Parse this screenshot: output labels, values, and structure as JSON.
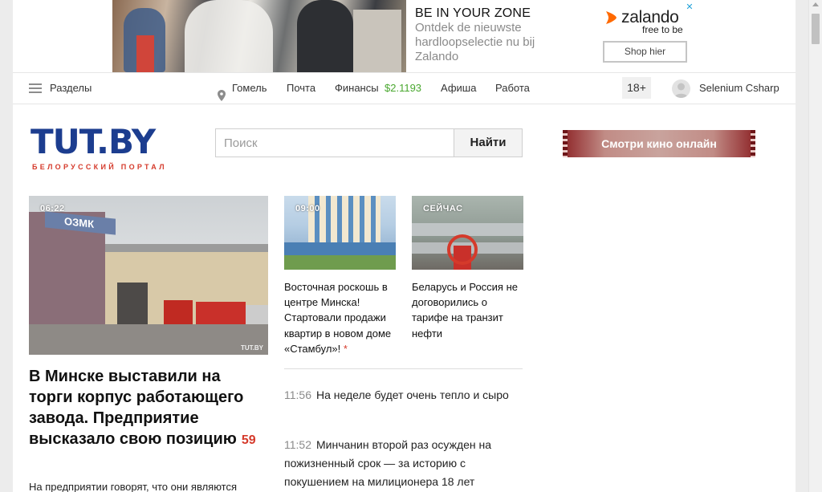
{
  "ad": {
    "headline": "BE IN YOUR ZONE",
    "text": "Ontdek de nieuwste hardloopselectie nu bij Zalando",
    "brand": "zalando",
    "tagline": "free to be",
    "cta": "Shop hier",
    "close": "✕",
    "brand_color": "#ff6900"
  },
  "nav": {
    "sections": "Разделы",
    "city": "Гомель",
    "mail": "Почта",
    "finance": "Финансы",
    "rate": "$2.1193",
    "afisha": "Афиша",
    "work": "Работа",
    "age": "18+",
    "user": "Selenium Csharp",
    "icons": [
      "menu-icon",
      "location-pin-icon",
      "user-avatar-icon"
    ]
  },
  "logo": {
    "text": "TUT.BY",
    "subtitle": "БЕЛОРУССКИЙ ПОРТАЛ",
    "primary_color": "#1c3d8f",
    "accent_color": "#d53a2b"
  },
  "search": {
    "placeholder": "Поиск",
    "button": "Найти"
  },
  "promo": {
    "kino": "Смотри кино онлайн"
  },
  "main_story": {
    "time": "06:22",
    "image_sign": "ОЗМК",
    "watermark": "TUT.BY",
    "title": "В Минске выставили на торги корпус работающего завода. Предприятие высказало свою позицию",
    "comments": "59",
    "lead": "На предприятии говорят, что они являются"
  },
  "cards": [
    {
      "time": "09:00",
      "title": "Восточная роскошь в центре Минска! Стартовали продажи квартир в новом доме «Стамбул»!",
      "marker": "*"
    },
    {
      "time": "СЕЙЧАС",
      "title": "Беларусь и Россия не договорились о тарифе на транзит нефти"
    }
  ],
  "feed": [
    {
      "time": "11:56",
      "title": "На неделе будет очень тепло и сыро"
    },
    {
      "time": "11:52",
      "title": "Минчанин второй раз осужден на пожизненный срок — за историю с покушением на милиционера 18 лет"
    }
  ]
}
